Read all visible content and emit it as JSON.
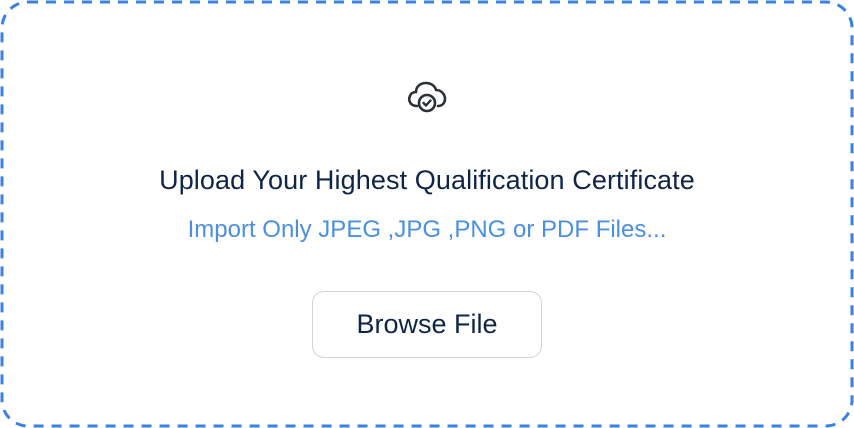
{
  "upload": {
    "icon": "cloud-check-icon",
    "title": "Upload Your Highest Qualification Certificate",
    "subtitle": "Import Only JPEG ,JPG ,PNG or PDF Files...",
    "browse_label": "Browse File"
  },
  "colors": {
    "border": "#3b82e0",
    "title": "#0f2547",
    "subtitle": "#4a8fe0",
    "button_border": "#cfd3dc"
  }
}
